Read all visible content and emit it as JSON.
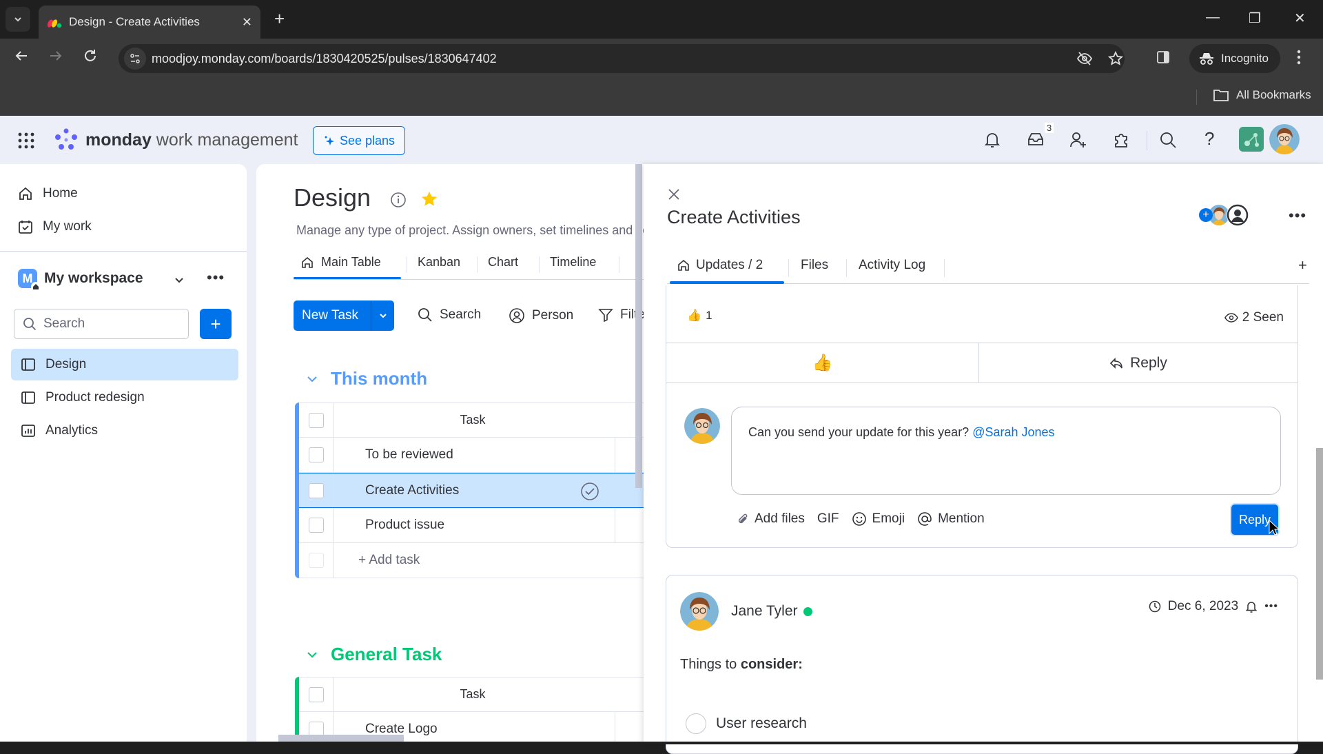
{
  "browser": {
    "tab_title": "Design - Create Activities",
    "url": "moodjoy.monday.com/boards/1830420525/pulses/1830647402",
    "incognito_label": "Incognito",
    "bookmarks_label": "All Bookmarks"
  },
  "header": {
    "brand_bold": "monday",
    "brand_rest": " work management",
    "see_plans": "See plans",
    "inbox_badge": "3"
  },
  "sidebar": {
    "top_items": [
      {
        "label": "Home",
        "icon": "home-icon"
      },
      {
        "label": "My work",
        "icon": "calendar-check-icon"
      }
    ],
    "workspace": {
      "initial": "M",
      "name": "My workspace"
    },
    "search_placeholder": "Search",
    "boards": [
      {
        "label": "Design",
        "icon": "board-icon",
        "active": true
      },
      {
        "label": "Product redesign",
        "icon": "board-icon",
        "active": false
      },
      {
        "label": "Analytics",
        "icon": "dashboard-icon",
        "active": false
      }
    ]
  },
  "board": {
    "title": "Design",
    "description": "Manage any type of project. Assign owners, set timelines and keep track of where your project stands.",
    "views": [
      "Main Table",
      "Kanban",
      "Chart",
      "Timeline"
    ],
    "new_task": "New Task",
    "tools": {
      "search": "Search",
      "person": "Person",
      "filter": "Filter"
    },
    "groups": [
      {
        "name": "This month",
        "color": "#579bfc",
        "column_header": "Task",
        "rows": [
          "To be reviewed",
          "Create Activities",
          "Product issue"
        ],
        "selected_row": "Create Activities",
        "add_label": "+ Add task"
      },
      {
        "name": "General Task",
        "color": "#00c875",
        "column_header": "Task",
        "rows": [
          "Create Logo"
        ]
      }
    ]
  },
  "item_panel": {
    "title": "Create Activities",
    "tabs": [
      {
        "label": "Updates / 2",
        "active": true
      },
      {
        "label": "Files",
        "active": false
      },
      {
        "label": "Activity Log",
        "active": false
      }
    ],
    "add_tab": "+",
    "update": {
      "like_count": "1",
      "seen": "2 Seen",
      "reply_label": "Reply"
    },
    "reply_box": {
      "text": "Can you send your update for this year? ",
      "mention": "@Sarah Jones",
      "tools": {
        "add_files": "Add files",
        "gif": "GIF",
        "emoji": "Emoji",
        "mention": "Mention"
      },
      "submit": "Reply"
    },
    "post": {
      "author": "Jane Tyler",
      "date": "Dec 6, 2023",
      "body_plain": "Things to ",
      "body_bold": "consider:",
      "checklist": [
        "User research"
      ]
    }
  }
}
